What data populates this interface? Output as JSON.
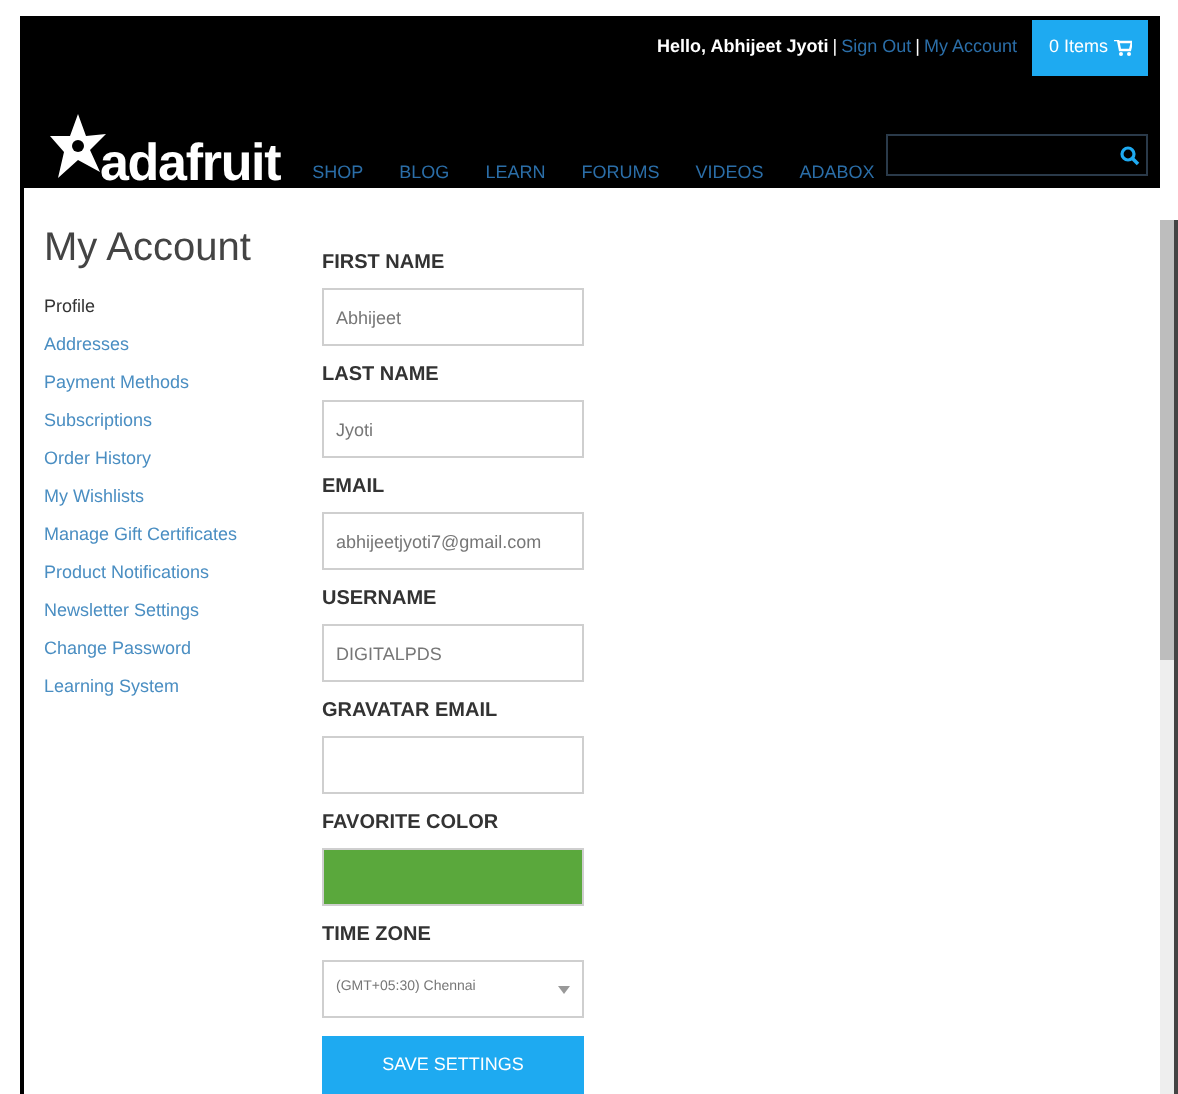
{
  "header": {
    "greeting": "Hello, Abhijeet Jyoti",
    "separator_1": "|",
    "sign_out": "Sign Out",
    "separator_2": "|",
    "my_account": "My Account",
    "cart": "0 Items",
    "logo": "adafruit",
    "nav": [
      "SHOP",
      "BLOG",
      "LEARN",
      "FORUMS",
      "VIDEOS",
      "ADABOX"
    ]
  },
  "page_title": "My Account",
  "sidebar": {
    "items": [
      {
        "label": "Profile",
        "selected": true
      },
      {
        "label": "Addresses",
        "selected": false
      },
      {
        "label": "Payment Methods",
        "selected": false
      },
      {
        "label": "Subscriptions",
        "selected": false
      },
      {
        "label": "Order History",
        "selected": false
      },
      {
        "label": "My Wishlists",
        "selected": false
      },
      {
        "label": "Manage Gift Certificates",
        "selected": false
      },
      {
        "label": "Product Notifications",
        "selected": false
      },
      {
        "label": "Newsletter Settings",
        "selected": false
      },
      {
        "label": "Change Password",
        "selected": false
      },
      {
        "label": "Learning System",
        "selected": false
      }
    ]
  },
  "form": {
    "fields": [
      {
        "kind": "text",
        "label": "FIRST NAME",
        "value": "Abhijeet"
      },
      {
        "kind": "text",
        "label": "LAST NAME",
        "value": "Jyoti"
      },
      {
        "kind": "text",
        "label": "EMAIL",
        "value": "abhijeetjyoti7@gmail.com"
      },
      {
        "kind": "text",
        "label": "USERNAME",
        "value": "DIGITALPDS"
      },
      {
        "kind": "text",
        "label": "GRAVATAR EMAIL"
      },
      {
        "kind": "color",
        "label": "FAVORITE COLOR",
        "color": "#5aa83c"
      },
      {
        "kind": "select",
        "label": "TIME ZONE",
        "value": "(GMT+05:30) Chennai"
      }
    ],
    "submit": "SAVE SETTINGS"
  }
}
